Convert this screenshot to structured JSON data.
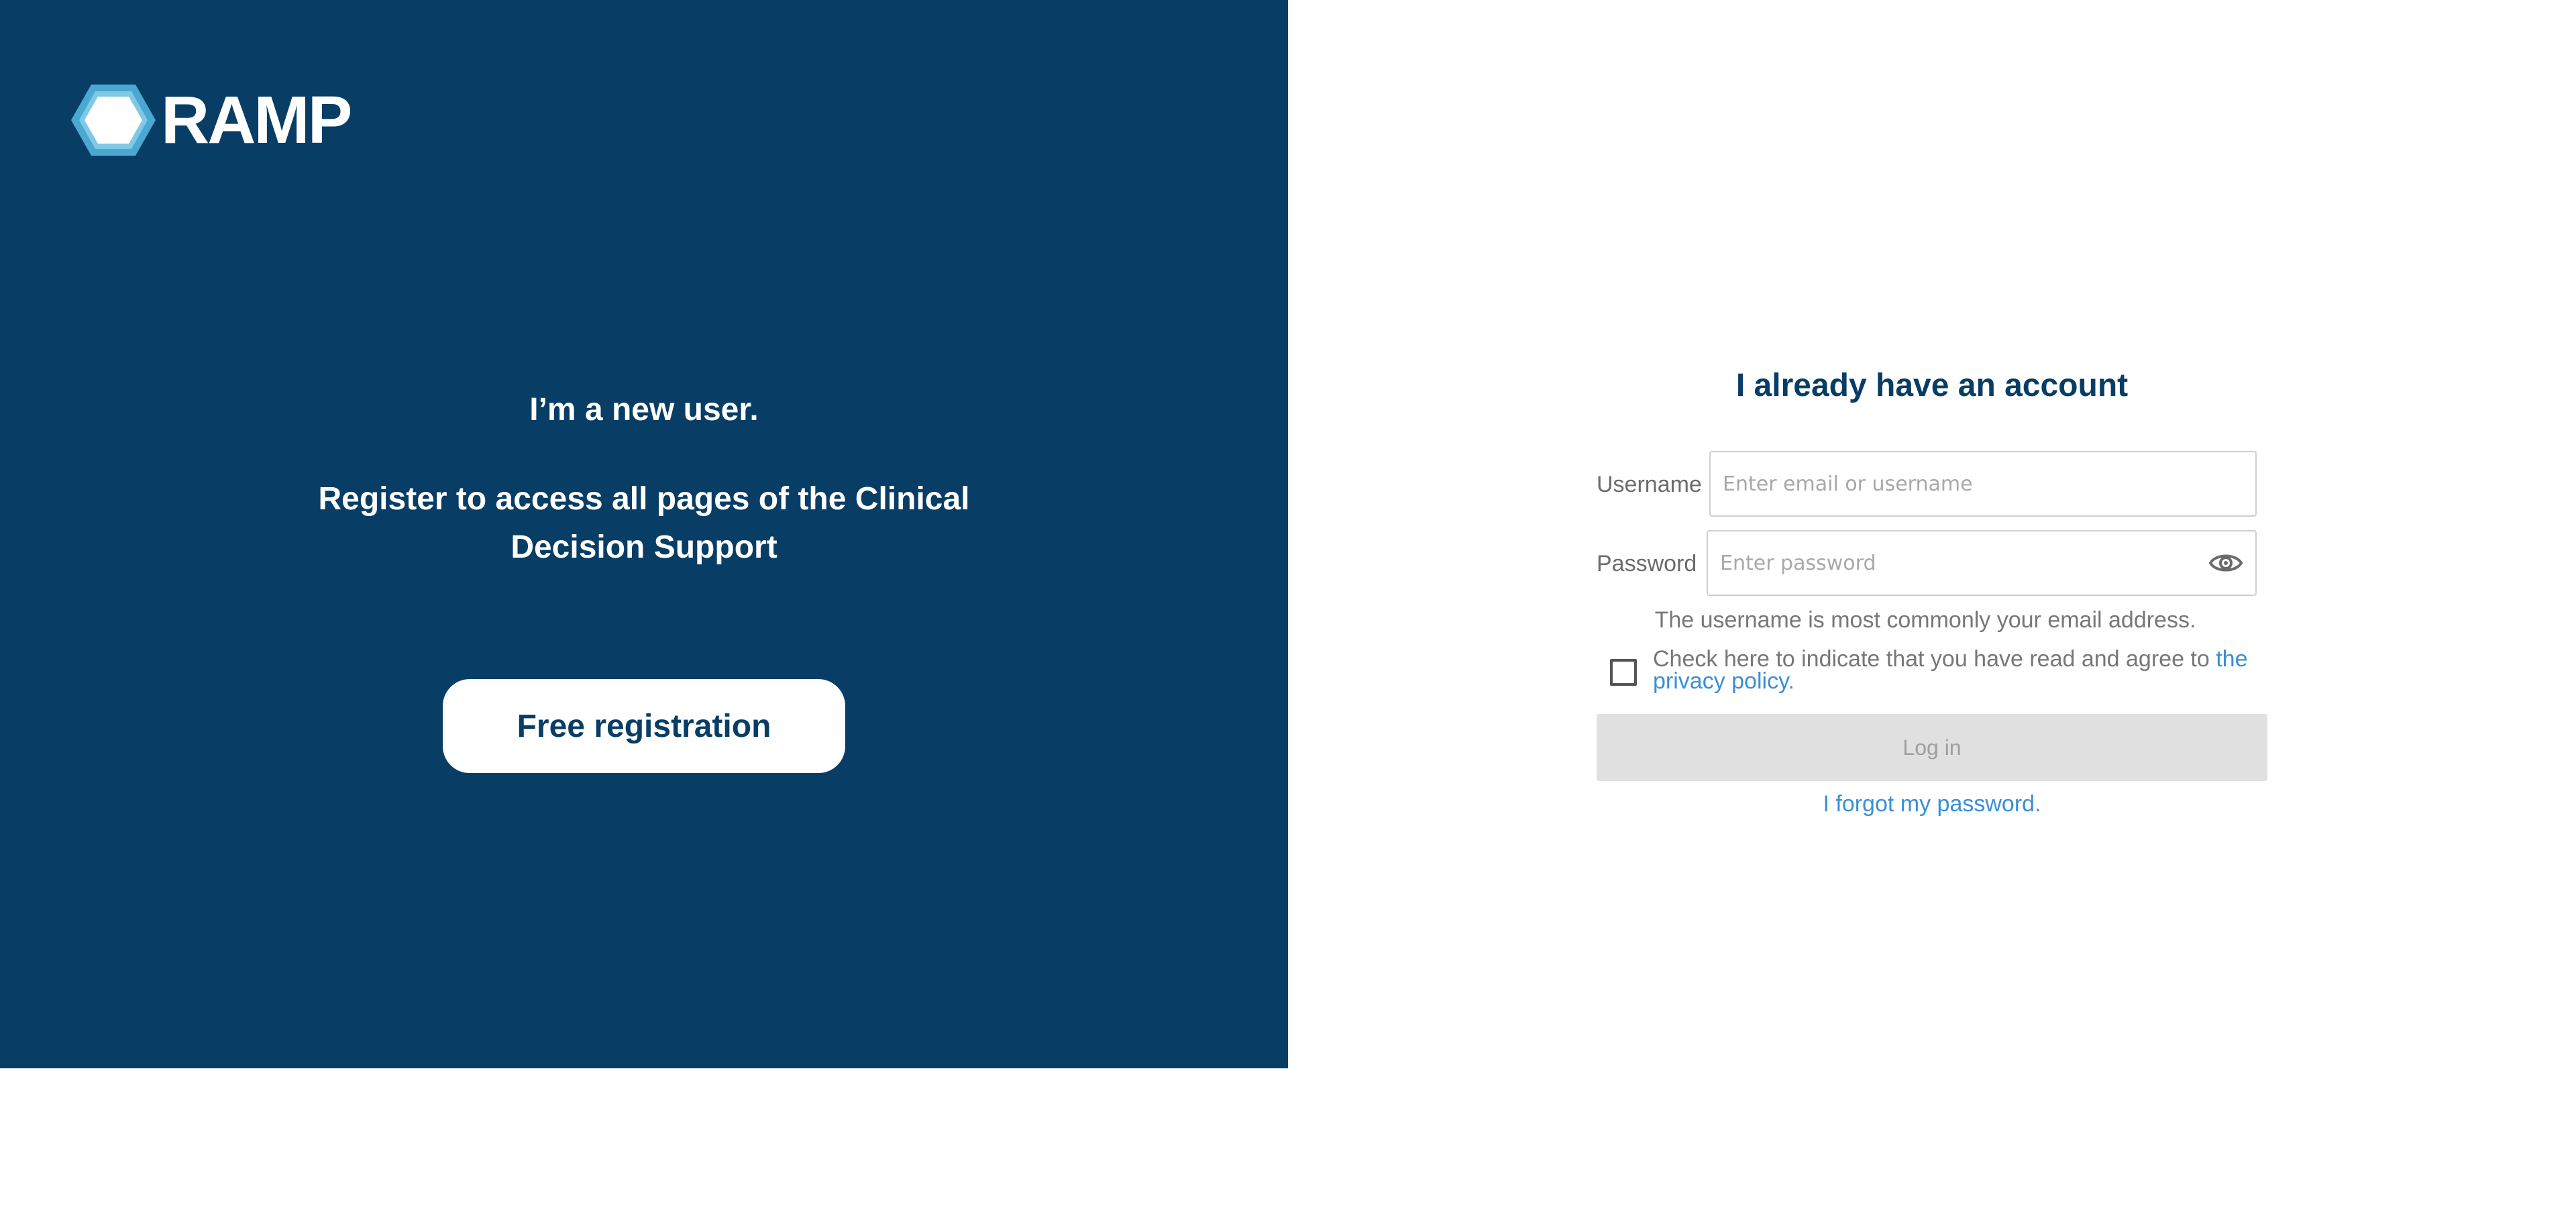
{
  "brand": {
    "logo_text": "RAMP",
    "logo_icon": "hexagon-logo-icon",
    "primary_color": "#083d65",
    "accent_color": "#3a8fd6",
    "logo_light": "#7fc9e6",
    "logo_dark": "#4aa8d2"
  },
  "new_user": {
    "title": "I’m a new user.",
    "subtitle": "Register to access all pages of the Clinical Decision Support",
    "register_label": "Free registration"
  },
  "login": {
    "title": "I already have an account",
    "username_label": "Username",
    "username_placeholder": "Enter email or username",
    "username_value": "",
    "password_label": "Password",
    "password_placeholder": "Enter password",
    "password_value": "",
    "password_toggle_icon": "eye-icon",
    "username_hint": "The username is most commonly your email address.",
    "privacy_text": "Check here to indicate that you have read and agree to ",
    "privacy_link": "the privacy policy",
    "privacy_suffix": ".",
    "privacy_checked": false,
    "login_label": "Log in",
    "forgot_password": "I forgot my password."
  }
}
